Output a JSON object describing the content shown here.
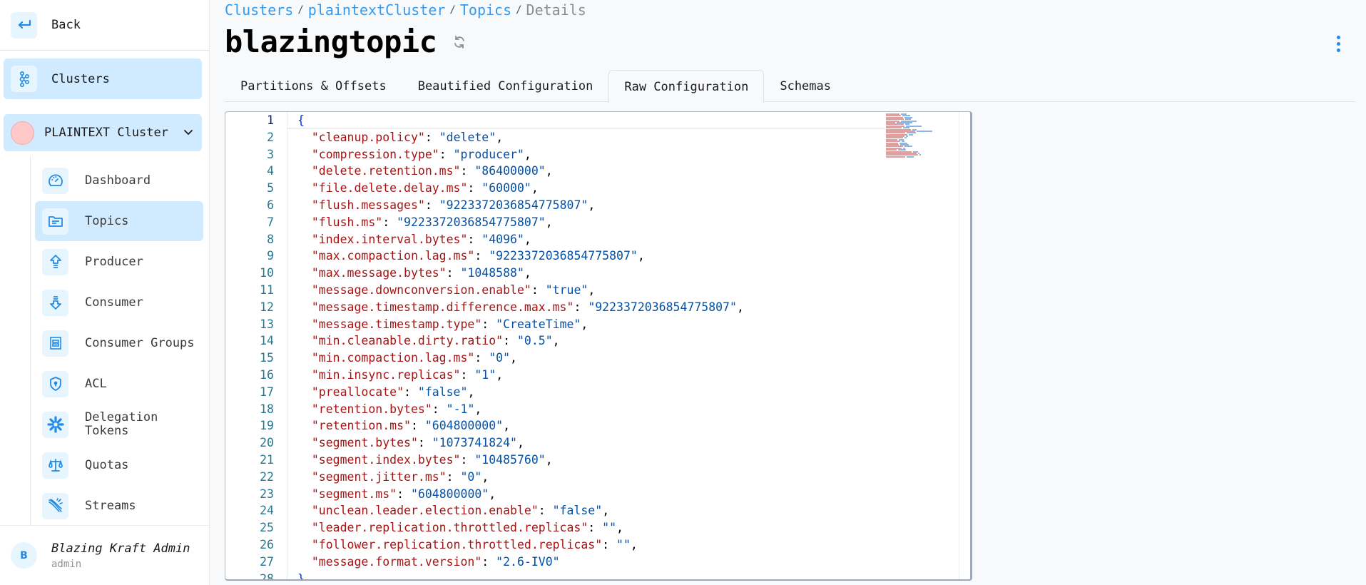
{
  "sidebar": {
    "back_label": "Back",
    "clusters_label": "Clusters",
    "cluster_name": "PLAINTEXT Cluster",
    "items": [
      {
        "label": "Dashboard",
        "icon": "gauge-icon",
        "active": false
      },
      {
        "label": "Topics",
        "icon": "folder-icon",
        "active": true
      },
      {
        "label": "Producer",
        "icon": "upload-arrow-icon",
        "active": false
      },
      {
        "label": "Consumer",
        "icon": "download-arrow-icon",
        "active": false
      },
      {
        "label": "Consumer Groups",
        "icon": "group-box-icon",
        "active": false
      },
      {
        "label": "ACL",
        "icon": "shield-lock-icon",
        "active": false
      },
      {
        "label": "Delegation Tokens",
        "icon": "asterisk-icon",
        "active": false
      },
      {
        "label": "Quotas",
        "icon": "scale-icon",
        "active": false
      },
      {
        "label": "Streams",
        "icon": "streams-icon",
        "active": false
      }
    ],
    "user": {
      "initial": "B",
      "name": "Blazing Kraft Admin",
      "role": "admin"
    }
  },
  "breadcrumb": [
    {
      "label": "Clusters",
      "link": true
    },
    {
      "label": "plaintextCluster",
      "link": true
    },
    {
      "label": "Topics",
      "link": true
    },
    {
      "label": "Details",
      "link": false
    }
  ],
  "breadcrumb_separator": "/",
  "page_title": "blazingtopic",
  "tabs": [
    {
      "label": "Partitions & Offsets",
      "active": false
    },
    {
      "label": "Beautified Configuration",
      "active": false
    },
    {
      "label": "Raw Configuration",
      "active": true
    },
    {
      "label": "Schemas",
      "active": false
    }
  ],
  "editor": {
    "open_brace": "{",
    "close_brace": "}",
    "entries": [
      {
        "key": "cleanup.policy",
        "value": "delete"
      },
      {
        "key": "compression.type",
        "value": "producer"
      },
      {
        "key": "delete.retention.ms",
        "value": "86400000"
      },
      {
        "key": "file.delete.delay.ms",
        "value": "60000"
      },
      {
        "key": "flush.messages",
        "value": "9223372036854775807"
      },
      {
        "key": "flush.ms",
        "value": "9223372036854775807"
      },
      {
        "key": "index.interval.bytes",
        "value": "4096"
      },
      {
        "key": "max.compaction.lag.ms",
        "value": "9223372036854775807"
      },
      {
        "key": "max.message.bytes",
        "value": "1048588"
      },
      {
        "key": "message.downconversion.enable",
        "value": "true"
      },
      {
        "key": "message.timestamp.difference.max.ms",
        "value": "9223372036854775807"
      },
      {
        "key": "message.timestamp.type",
        "value": "CreateTime"
      },
      {
        "key": "min.cleanable.dirty.ratio",
        "value": "0.5"
      },
      {
        "key": "min.compaction.lag.ms",
        "value": "0"
      },
      {
        "key": "min.insync.replicas",
        "value": "1"
      },
      {
        "key": "preallocate",
        "value": "false"
      },
      {
        "key": "retention.bytes",
        "value": "-1"
      },
      {
        "key": "retention.ms",
        "value": "604800000"
      },
      {
        "key": "segment.bytes",
        "value": "1073741824"
      },
      {
        "key": "segment.index.bytes",
        "value": "10485760"
      },
      {
        "key": "segment.jitter.ms",
        "value": "0"
      },
      {
        "key": "segment.ms",
        "value": "604800000"
      },
      {
        "key": "unclean.leader.election.enable",
        "value": "false"
      },
      {
        "key": "leader.replication.throttled.replicas",
        "value": ""
      },
      {
        "key": "follower.replication.throttled.replicas",
        "value": ""
      },
      {
        "key": "message.format.version",
        "value": "2.6-IV0"
      }
    ]
  },
  "colors": {
    "accent": "#228be6",
    "active_bg": "#d0ebff",
    "json_key": "#a31515",
    "json_string": "#0451a5",
    "line_number": "#237893"
  }
}
